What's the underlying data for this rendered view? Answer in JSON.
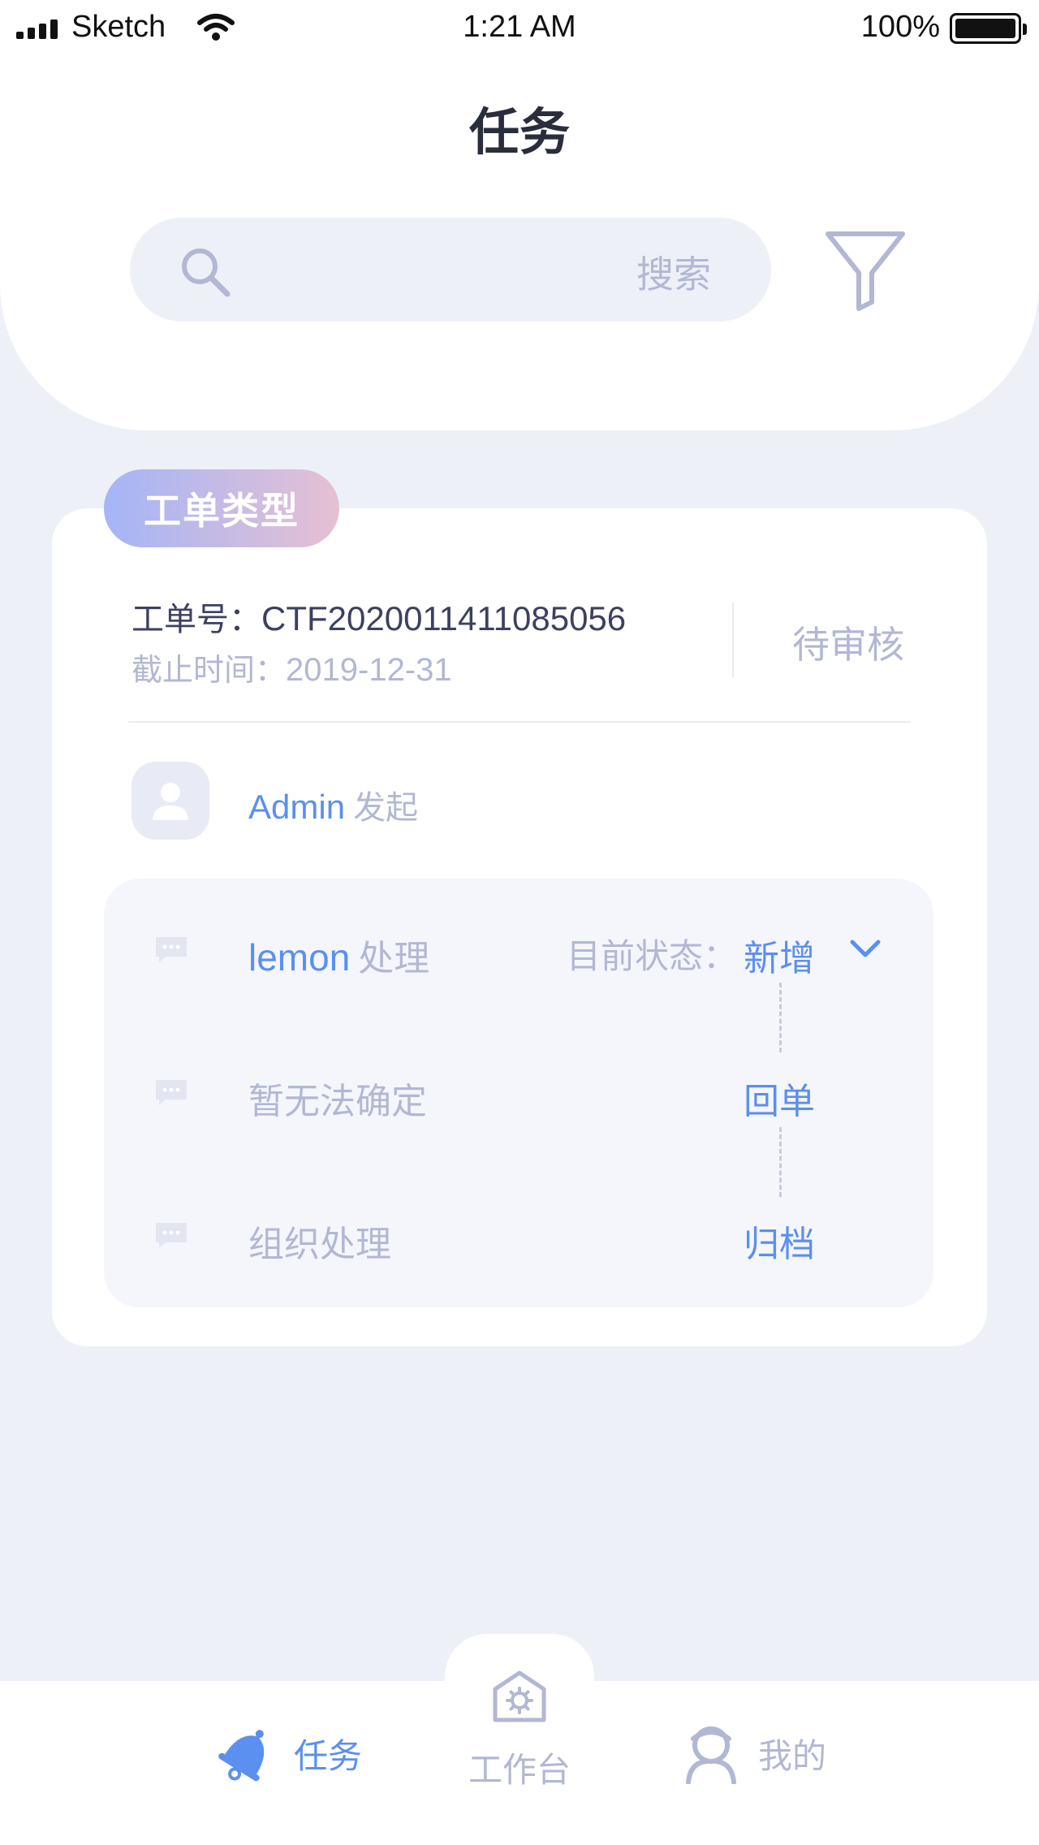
{
  "status_bar": {
    "carrier": "Sketch",
    "time": "1:21 AM",
    "battery": "100%"
  },
  "header": {
    "title": "任务",
    "search_placeholder": "搜索"
  },
  "card": {
    "type_badge": "工单类型",
    "order_no_label": "工单号：",
    "order_no": "CTF2020011411085056",
    "deadline_label": "截止时间：",
    "deadline": "2019-12-31",
    "status": "待审核",
    "initiator_name": "Admin",
    "initiator_action": "发起",
    "current_state_label": "目前状态：",
    "steps": [
      {
        "who": "lemon",
        "action": "处理",
        "state": "新增"
      },
      {
        "who": "",
        "action": "暂无法确定",
        "state": "回单"
      },
      {
        "who": "",
        "action": "组织处理",
        "state": "归档"
      }
    ]
  },
  "tabbar": {
    "tasks": "任务",
    "workbench": "工作台",
    "mine": "我的"
  },
  "colors": {
    "accent": "#5b8ff0",
    "muted": "#b2b7d3",
    "background": "#eef0f8",
    "badge_gradient_start": "#a4b5f7",
    "badge_gradient_end": "#e6c0d3"
  }
}
